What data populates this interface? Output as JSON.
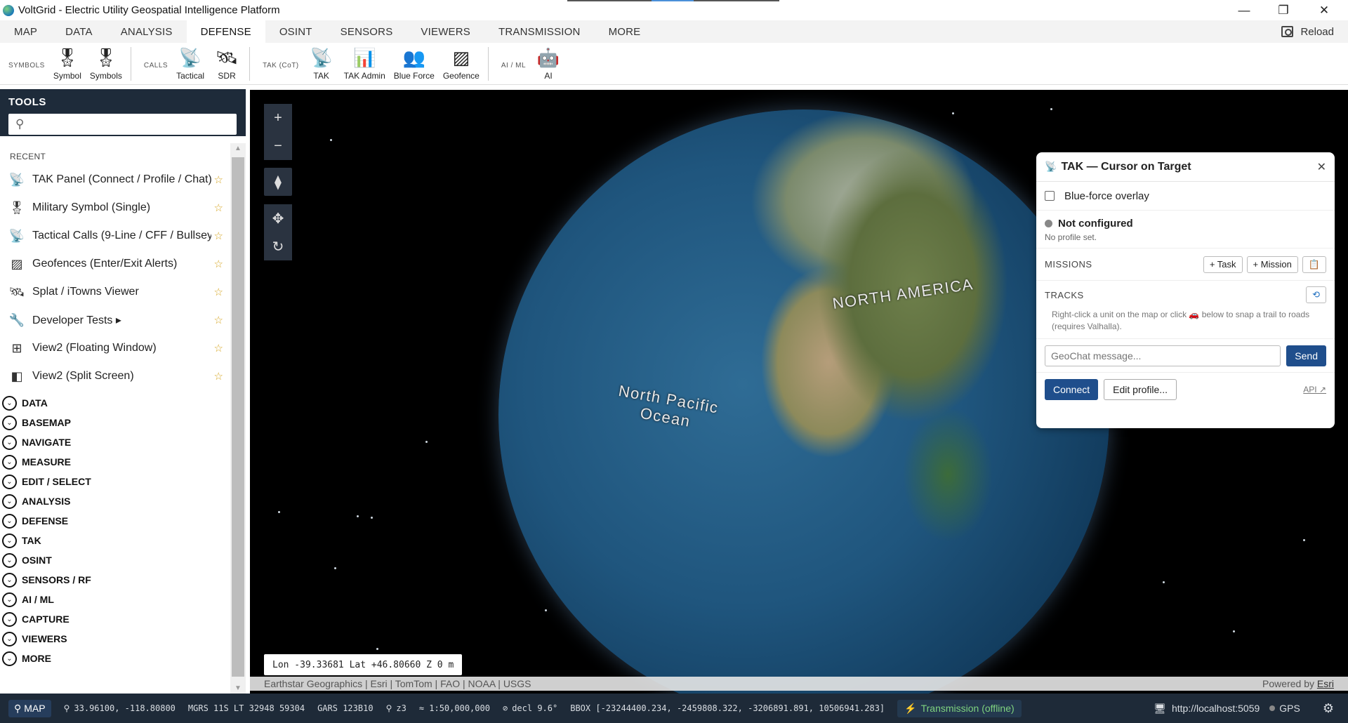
{
  "window": {
    "title": "VoltGrid - Electric Utility Geospatial Intelligence Platform",
    "minimize": "—",
    "restore": "❐",
    "close": "✕"
  },
  "menu": {
    "tabs": [
      "MAP",
      "DATA",
      "ANALYSIS",
      "DEFENSE",
      "OSINT",
      "SENSORS",
      "VIEWERS",
      "TRANSMISSION",
      "MORE"
    ],
    "active": "DEFENSE",
    "reload": "Reload"
  },
  "ribbon": {
    "groups": [
      {
        "label": "SYMBOLS",
        "buttons": [
          {
            "label": "Symbol",
            "icon": "medal-icon"
          },
          {
            "label": "Symbols",
            "icon": "medal-icon"
          }
        ]
      },
      {
        "label": "CALLS",
        "buttons": [
          {
            "label": "Tactical",
            "icon": "radio-icon"
          },
          {
            "label": "SDR",
            "icon": "satellite-icon"
          }
        ]
      },
      {
        "label": "TAK (CoT)",
        "buttons": [
          {
            "label": "TAK",
            "icon": "radio-icon"
          },
          {
            "label": "TAK Admin",
            "icon": "chart-icon"
          },
          {
            "label": "Blue Force",
            "icon": "people-icon"
          },
          {
            "label": "Geofence",
            "icon": "fence-icon"
          }
        ]
      },
      {
        "label": "AI / ML",
        "buttons": [
          {
            "label": "AI",
            "icon": "robot-icon"
          }
        ]
      }
    ]
  },
  "tools": {
    "title": "TOOLS",
    "search_placeholder": "",
    "recent_label": "RECENT",
    "recent": [
      {
        "label": "TAK Panel (Connect / Profile / Chat)",
        "icon": "radio-icon"
      },
      {
        "label": "Military Symbol (Single)",
        "icon": "medal-icon"
      },
      {
        "label": "Tactical Calls (9-Line / CFF / Bullseye)",
        "icon": "radio-icon"
      },
      {
        "label": "Geofences (Enter/Exit Alerts)",
        "icon": "fence-icon"
      },
      {
        "label": "Splat / iTowns Viewer",
        "icon": "satellite-icon"
      },
      {
        "label": "Developer Tests ▸",
        "icon": "wrench-icon"
      },
      {
        "label": "View2 (Floating Window)",
        "icon": "window-icon"
      },
      {
        "label": "View2 (Split Screen)",
        "icon": "split-icon"
      }
    ],
    "categories": [
      "DATA",
      "BASEMAP",
      "NAVIGATE",
      "MEASURE",
      "EDIT / SELECT",
      "ANALYSIS",
      "DEFENSE",
      "TAK",
      "OSINT",
      "SENSORS / RF",
      "AI / ML",
      "CAPTURE",
      "VIEWERS",
      "MORE"
    ]
  },
  "map": {
    "labels": {
      "continent": "NORTH AMERICA",
      "ocean": "North Pacific Ocean"
    },
    "readout": "Lon -39.33681  Lat +46.80660  Z 0 m",
    "attribution": "Earthstar Geographics | Esri | TomTom | FAO | NOAA | USGS",
    "powered_by": "Powered by",
    "powered_link": "Esri"
  },
  "tak_panel": {
    "title": "TAK — Cursor on Target",
    "blue_force": "Blue-force overlay",
    "status": "Not configured",
    "profile": "No profile set.",
    "missions_label": "MISSIONS",
    "add_task": "+ Task",
    "add_mission": "+ Mission",
    "tracks_label": "TRACKS",
    "tracks_hint_a": "Right-click a unit on the map or click",
    "tracks_hint_b": "below to snap a trail to roads (requires Valhalla).",
    "chat_placeholder": "GeoChat message...",
    "send": "Send",
    "connect": "Connect",
    "edit_profile": "Edit profile...",
    "api": "API ↗"
  },
  "statusbar": {
    "map_badge": "MAP",
    "latlon": "33.96100, -118.80800",
    "mgrs": "MGRS 11S LT 32948 59304",
    "gars": "GARS 123B10",
    "zoom": "z3",
    "scale": "≈ 1:50,000,000",
    "decl": "decl 9.6°",
    "bbox": "BBOX [-23244400.234, -2459808.322, -3206891.891, 10506941.283]",
    "transmission": "Transmission (offline)",
    "server": "http://localhost:5059",
    "gps": "GPS"
  }
}
